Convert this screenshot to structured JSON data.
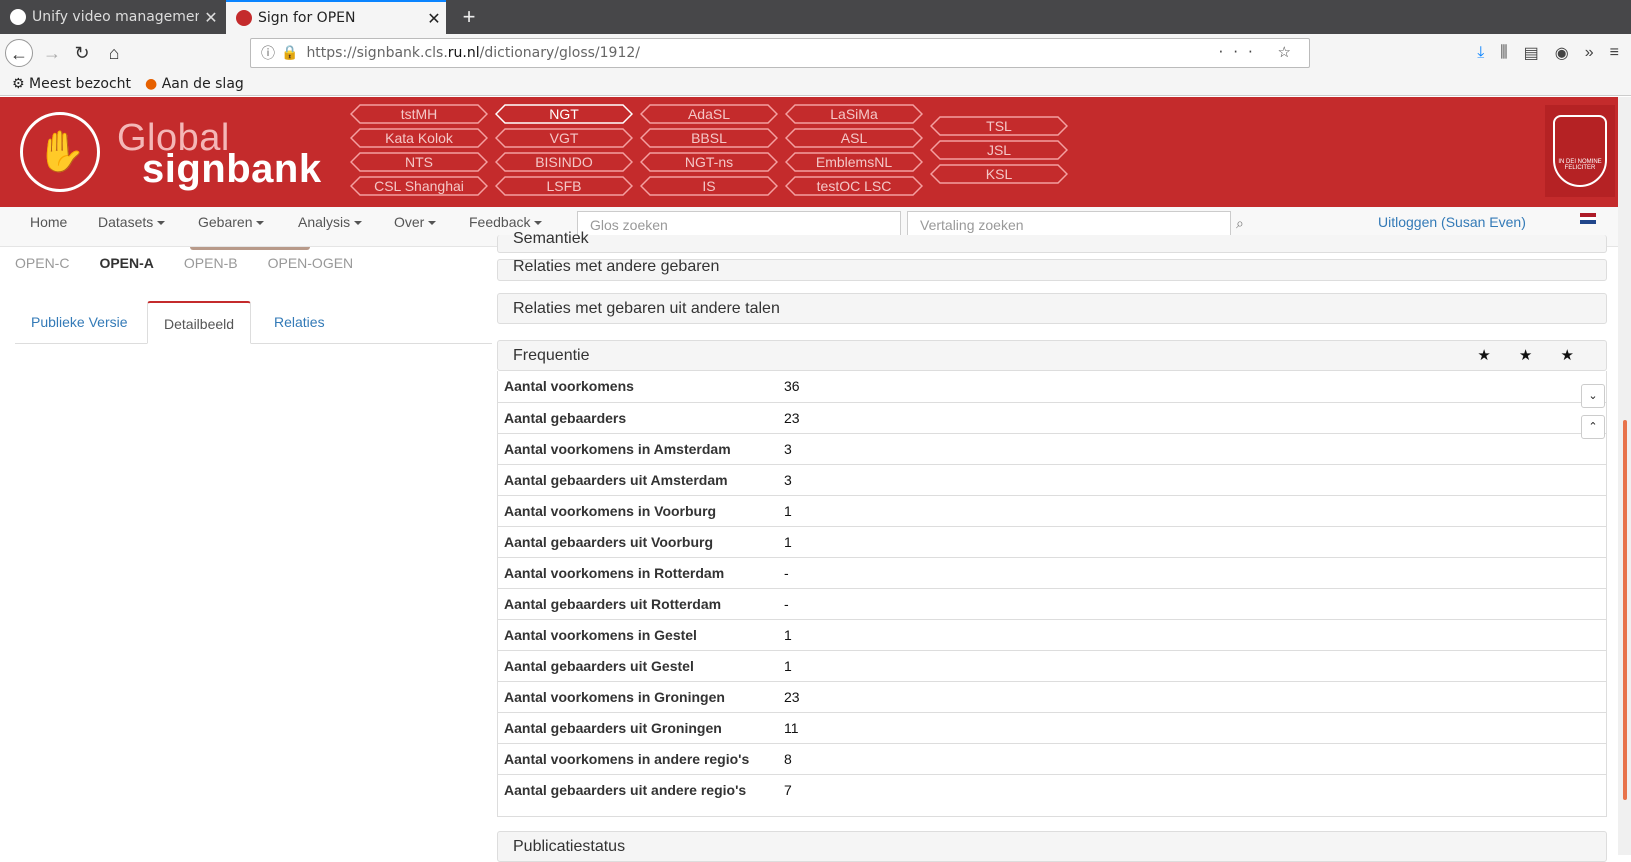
{
  "browser": {
    "tabs": [
      {
        "title": "Unify video managemen",
        "active": false
      },
      {
        "title": "Sign for OPEN",
        "active": true
      }
    ],
    "url_prefix": "https://signbank.cls.",
    "url_domain": "ru.nl",
    "url_path": "/dictionary/gloss/1912/",
    "bookmarks": [
      "Meest bezocht",
      "Aan de slag"
    ]
  },
  "header": {
    "logo_line1": "Global",
    "logo_line2": "signbank",
    "seal_text": "IN DEI NOMINE FELICITER",
    "datasets": [
      "tstMH",
      "Kata Kolok",
      "NTS",
      "CSL Shanghai",
      "NGT",
      "VGT",
      "BISINDO",
      "LSFB",
      "AdaSL",
      "BBSL",
      "NGT-ns",
      "IS",
      "LaSiMa",
      "ASL",
      "EmblemsNL",
      "testOC LSC",
      "TSL",
      "JSL",
      "KSL"
    ],
    "selected_dataset": "NGT"
  },
  "menu": {
    "home": "Home",
    "datasets": "Datasets",
    "gebaren": "Gebaren",
    "analysis": "Analysis",
    "over": "Over",
    "feedback": "Feedback",
    "gloss_search_placeholder": "Glos zoeken",
    "translation_search_placeholder": "Vertaling zoeken",
    "logout": "Uitloggen (Susan Even)"
  },
  "left": {
    "subtabs": [
      "OPEN-C",
      "OPEN-A",
      "OPEN-B",
      "OPEN-OGEN"
    ],
    "active_subtab": "OPEN-A",
    "tabs": [
      "Publieke Versie",
      "Detailbeeld",
      "Relaties"
    ],
    "active_tab": "Detailbeeld"
  },
  "panels": {
    "semantiek": "Semantiek",
    "relaties_andere": "Relaties met andere gebaren",
    "relaties_talen": "Relaties met gebaren uit andere talen",
    "frequentie": "Frequentie",
    "stars": "★ ★ ★",
    "publicatiestatus": "Publicatiestatus"
  },
  "frequency": [
    {
      "label": "Aantal voorkomens",
      "value": "36"
    },
    {
      "label": "Aantal gebaarders",
      "value": "23"
    },
    {
      "label": "Aantal voorkomens in Amsterdam",
      "value": "3"
    },
    {
      "label": "Aantal gebaarders uit Amsterdam",
      "value": "3"
    },
    {
      "label": "Aantal voorkomens in Voorburg",
      "value": "1"
    },
    {
      "label": "Aantal gebaarders uit Voorburg",
      "value": "1"
    },
    {
      "label": "Aantal voorkomens in Rotterdam",
      "value": "-"
    },
    {
      "label": "Aantal gebaarders uit Rotterdam",
      "value": "-"
    },
    {
      "label": "Aantal voorkomens in Gestel",
      "value": "1"
    },
    {
      "label": "Aantal gebaarders uit Gestel",
      "value": "1"
    },
    {
      "label": "Aantal voorkomens in Groningen",
      "value": "23"
    },
    {
      "label": "Aantal gebaarders uit Groningen",
      "value": "11"
    },
    {
      "label": "Aantal voorkomens in andere regio's",
      "value": "8"
    },
    {
      "label": "Aantal gebaarders uit andere regio's",
      "value": "7"
    }
  ],
  "colors": {
    "brand_red": "#c42b2c",
    "link_blue": "#337ab7"
  }
}
